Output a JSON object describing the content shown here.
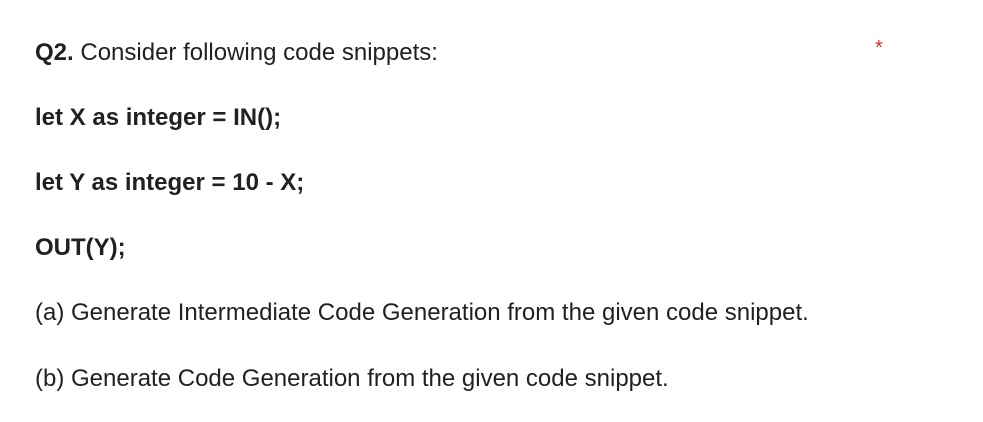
{
  "question": {
    "number": "Q2.",
    "title": "Consider following code snippets:",
    "required_mark": "*",
    "required_mark_color": "#d93025",
    "code_lines": [
      "let X as integer = IN();",
      "let Y as integer = 10 - X;",
      "OUT(Y);"
    ],
    "parts": [
      "(a) Generate Intermediate Code Generation from the given code snippet.",
      "(b) Generate Code Generation from the given code snippet."
    ]
  }
}
